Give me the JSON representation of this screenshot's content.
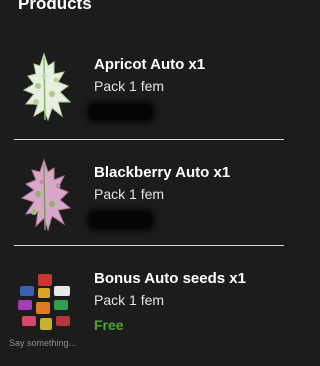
{
  "header": {
    "title": "Products"
  },
  "products": [
    {
      "name": "Apricot Auto x1",
      "pack": "Pack 1 fem",
      "price": ""
    },
    {
      "name": "Blackberry Auto x1",
      "pack": "Pack 1 fem",
      "price": ""
    },
    {
      "name": "Bonus Auto seeds x1",
      "pack": "Pack 1 fem",
      "price": "Free"
    }
  ],
  "chat": {
    "placeholder": "Say something..."
  },
  "colors": {
    "background": "#1c1c1c",
    "free": "#4aa62b",
    "divider": "#d9d9d9"
  }
}
